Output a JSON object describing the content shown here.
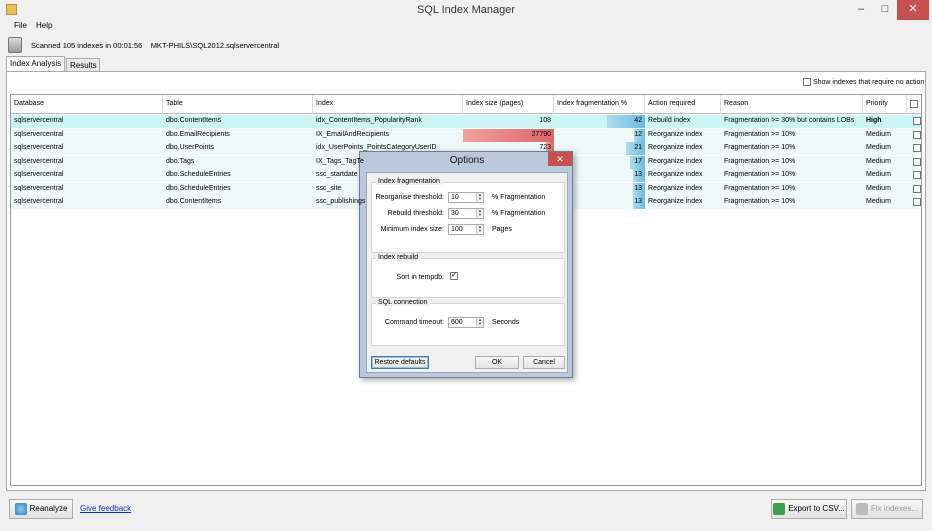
{
  "window": {
    "title": "SQL Index Manager"
  },
  "menu": {
    "items": [
      "File",
      "Help"
    ]
  },
  "status": {
    "scan_text": "Scanned 105 indexes in 00:01:56",
    "server": "MKT-PHILS\\SQL2012.sqlservercentral"
  },
  "tabs": [
    {
      "label": "Index Analysis",
      "active": true
    },
    {
      "label": "Results",
      "active": false
    }
  ],
  "filter": {
    "show_no_action_label": "Show indexes that require no action",
    "checked": false
  },
  "grid": {
    "columns": [
      "Database",
      "Table",
      "Index",
      "Index size (pages)",
      "Index fragmentation %",
      "Action required",
      "Reason",
      "Priority"
    ],
    "rows": [
      {
        "database": "sqlservercentral",
        "table": "dbo.ContentItems",
        "index": "idx_ContentItems_PopularityRank",
        "size": "108",
        "size_pct": 0.0,
        "frag": "42",
        "frag_pct": 0.42,
        "action": "Rebuild index",
        "reason": "Fragmentation >= 30% but contains LOBs",
        "priority": "High",
        "selected": true
      },
      {
        "database": "sqlservercentral",
        "table": "dbo.EmailRecipients",
        "index": "IX_EmailAndRecipients",
        "size": "27790",
        "size_pct": 1.0,
        "frag": "12",
        "frag_pct": 0.12,
        "action": "Reorganize index",
        "reason": "Fragmentation >= 10%",
        "priority": "Medium",
        "selected": false
      },
      {
        "database": "sqlservercentral",
        "table": "dbo.UserPoints",
        "index": "idx_UserPoints_PointsCategoryUserID",
        "size": "723",
        "size_pct": 0.03,
        "frag": "21",
        "frag_pct": 0.21,
        "action": "Reorganize index",
        "reason": "Fragmentation >= 10%",
        "priority": "Medium",
        "selected": false
      },
      {
        "database": "sqlservercentral",
        "table": "dbo.Tags",
        "index": "IX_Tags_TagTe",
        "size": "",
        "size_pct": 0.0,
        "frag": "17",
        "frag_pct": 0.17,
        "action": "Reorganize index",
        "reason": "Fragmentation >= 10%",
        "priority": "Medium",
        "selected": false
      },
      {
        "database": "sqlservercentral",
        "table": "dbo.ScheduleEntries",
        "index": "ssc_startdate",
        "size": "",
        "size_pct": 0.0,
        "frag": "13",
        "frag_pct": 0.13,
        "action": "Reorganize index",
        "reason": "Fragmentation >= 10%",
        "priority": "Medium",
        "selected": false
      },
      {
        "database": "sqlservercentral",
        "table": "dbo.ScheduleEntries",
        "index": "ssc_site",
        "size": "",
        "size_pct": 0.0,
        "frag": "13",
        "frag_pct": 0.13,
        "action": "Reorganize index",
        "reason": "Fragmentation >= 10%",
        "priority": "Medium",
        "selected": false
      },
      {
        "database": "sqlservercentral",
        "table": "dbo.ContentItems",
        "index": "ssc_publishings",
        "size": "",
        "size_pct": 0.0,
        "frag": "13",
        "frag_pct": 0.13,
        "action": "Reorganize index",
        "reason": "Fragmentation >= 10%",
        "priority": "Medium",
        "selected": false
      }
    ]
  },
  "buttons": {
    "reanalyze": "Reanalyze",
    "feedback": "Give feedback",
    "export": "Export to CSV...",
    "fix": "Fix indexes..."
  },
  "dialog": {
    "title": "Options",
    "close_glyph": "✕",
    "fragmentation": {
      "title": "Index fragmentation",
      "reorganise_label": "Reorganise threshold:",
      "reorganise_value": "10",
      "reorganise_unit": "% Fragmentation",
      "rebuild_label": "Rebuild threshold:",
      "rebuild_value": "30",
      "rebuild_unit": "% Fragmentation",
      "min_size_label": "Minimum index size:",
      "min_size_value": "100",
      "min_size_unit": "Pages"
    },
    "rebuild": {
      "title": "Index rebuild",
      "sort_label": "Sort in tempdb:",
      "sort_checked": true
    },
    "connection": {
      "title": "SQL connection",
      "timeout_label": "Command timeout:",
      "timeout_value": "600",
      "timeout_unit": "Seconds"
    },
    "restore_label": "Restore defaults",
    "ok_label": "OK",
    "cancel_label": "Cancel"
  },
  "colors": {
    "selected_row": "#ccf6f6",
    "size_bar": "#e06464",
    "frag_bar": "#6bbbe0",
    "close_button": "#c75050"
  }
}
